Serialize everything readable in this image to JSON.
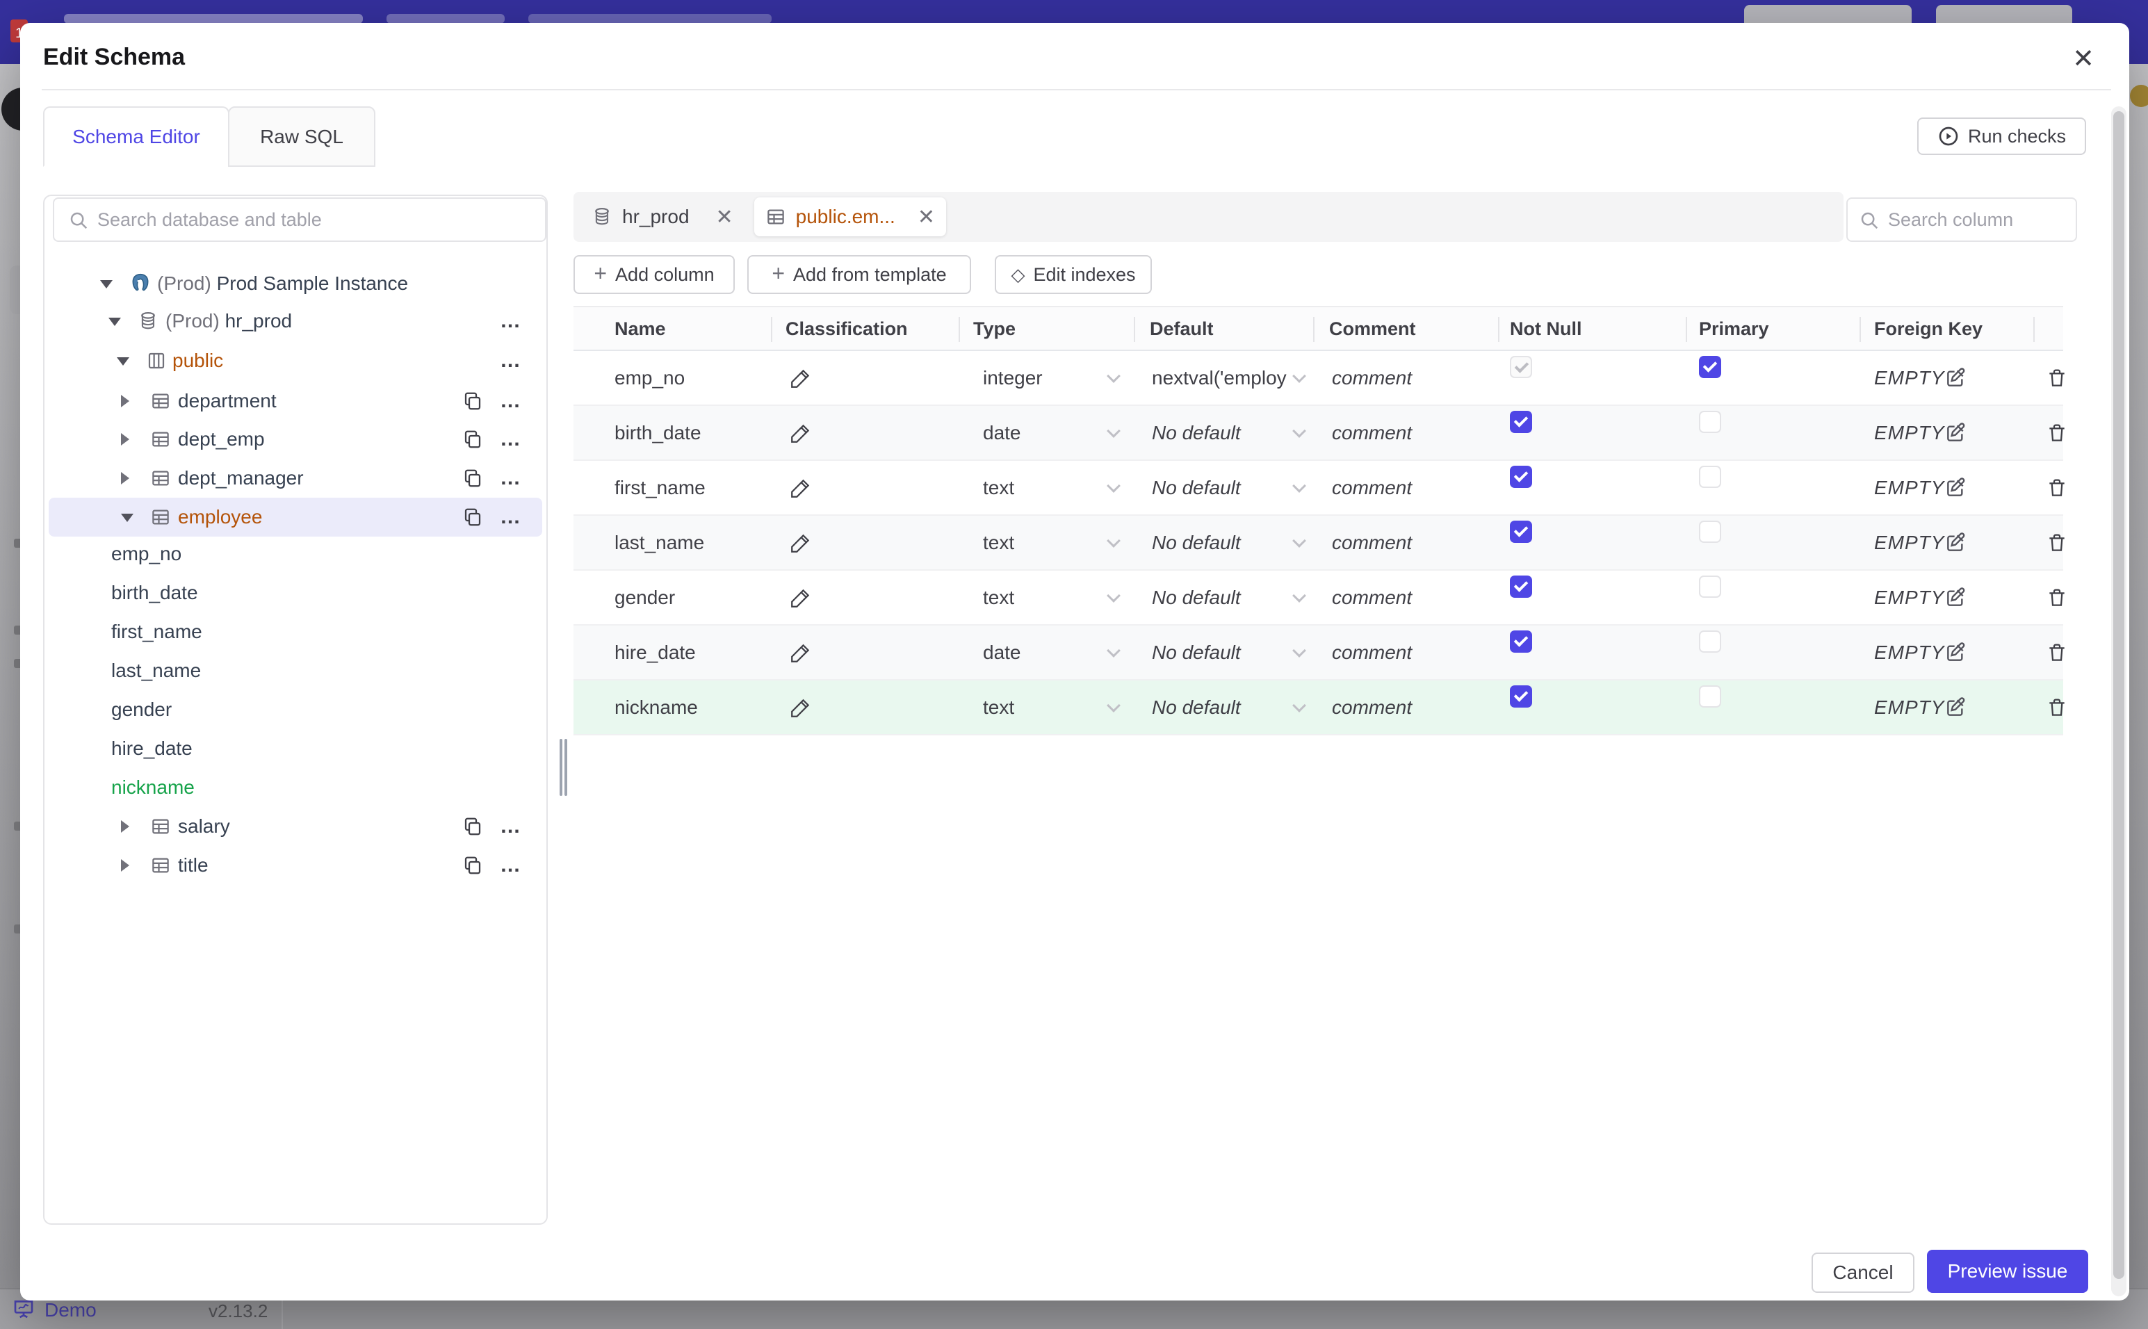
{
  "colors": {
    "accent": "#4f46e5",
    "modified_orange": "#b45309",
    "added_green": "#16a34a",
    "added_row_bg": "#e9f8ef",
    "selected_row_bg": "#ebebfa",
    "backdrop_header": "#35309d"
  },
  "backdrop": {
    "statusbar": {
      "brand": "Demo",
      "version": "v2.13.2"
    }
  },
  "modal": {
    "title": "Edit Schema",
    "close_icon": "✕",
    "tabs": [
      {
        "label": "Schema Editor",
        "active": true
      },
      {
        "label": "Raw SQL",
        "active": false
      }
    ],
    "run_checks_label": "Run checks",
    "sidebar": {
      "search_placeholder": "Search database and table",
      "tree": [
        {
          "kind": "instance",
          "prefix": "(Prod) ",
          "label": "Prod Sample Instance"
        },
        {
          "kind": "database",
          "prefix": "(Prod) ",
          "label": "hr_prod"
        },
        {
          "kind": "schema",
          "label": "public",
          "state": "modified"
        },
        {
          "kind": "table",
          "label": "department"
        },
        {
          "kind": "table",
          "label": "dept_emp"
        },
        {
          "kind": "table",
          "label": "dept_manager"
        },
        {
          "kind": "table",
          "label": "employee",
          "state": "modified",
          "selected": true
        },
        {
          "kind": "column",
          "label": "emp_no"
        },
        {
          "kind": "column",
          "label": "birth_date"
        },
        {
          "kind": "column",
          "label": "first_name"
        },
        {
          "kind": "column",
          "label": "last_name"
        },
        {
          "kind": "column",
          "label": "gender"
        },
        {
          "kind": "column",
          "label": "hire_date"
        },
        {
          "kind": "column",
          "label": "nickname",
          "state": "added"
        },
        {
          "kind": "table",
          "label": "salary"
        },
        {
          "kind": "table",
          "label": "title"
        }
      ]
    },
    "editor": {
      "chips": [
        {
          "label": "hr_prod",
          "kind": "database",
          "close": "✕"
        },
        {
          "label": "public.em...",
          "kind": "table",
          "close": "✕",
          "active": true
        }
      ],
      "toolbar": {
        "add_column": "Add column",
        "add_from_template": "Add from template",
        "edit_indexes": "Edit indexes"
      },
      "column_search_placeholder": "Search column",
      "table": {
        "headers": [
          "Name",
          "Classification",
          "Type",
          "Default",
          "Comment",
          "Not Null",
          "Primary",
          "Foreign Key"
        ],
        "comment_placeholder": "comment",
        "no_default_placeholder": "No default",
        "fk_placeholder": "EMPTY",
        "rows": [
          {
            "name": "emp_no",
            "type": "integer",
            "default": "nextval('employ",
            "has_default": true,
            "not_null": "locked",
            "primary": true,
            "foreign_key": "EMPTY"
          },
          {
            "name": "birth_date",
            "type": "date",
            "default": "No default",
            "has_default": false,
            "not_null": "on",
            "primary": false,
            "foreign_key": "EMPTY"
          },
          {
            "name": "first_name",
            "type": "text",
            "default": "No default",
            "has_default": false,
            "not_null": "on",
            "primary": false,
            "foreign_key": "EMPTY"
          },
          {
            "name": "last_name",
            "type": "text",
            "default": "No default",
            "has_default": false,
            "not_null": "on",
            "primary": false,
            "foreign_key": "EMPTY"
          },
          {
            "name": "gender",
            "type": "text",
            "default": "No default",
            "has_default": false,
            "not_null": "on",
            "primary": false,
            "foreign_key": "EMPTY"
          },
          {
            "name": "hire_date",
            "type": "date",
            "default": "No default",
            "has_default": false,
            "not_null": "on",
            "primary": false,
            "foreign_key": "EMPTY"
          },
          {
            "name": "nickname",
            "type": "text",
            "default": "No default",
            "has_default": false,
            "not_null": "on",
            "primary": false,
            "foreign_key": "EMPTY",
            "state": "added"
          }
        ]
      }
    },
    "footer": {
      "cancel_label": "Cancel",
      "primary_label": "Preview issue"
    }
  }
}
